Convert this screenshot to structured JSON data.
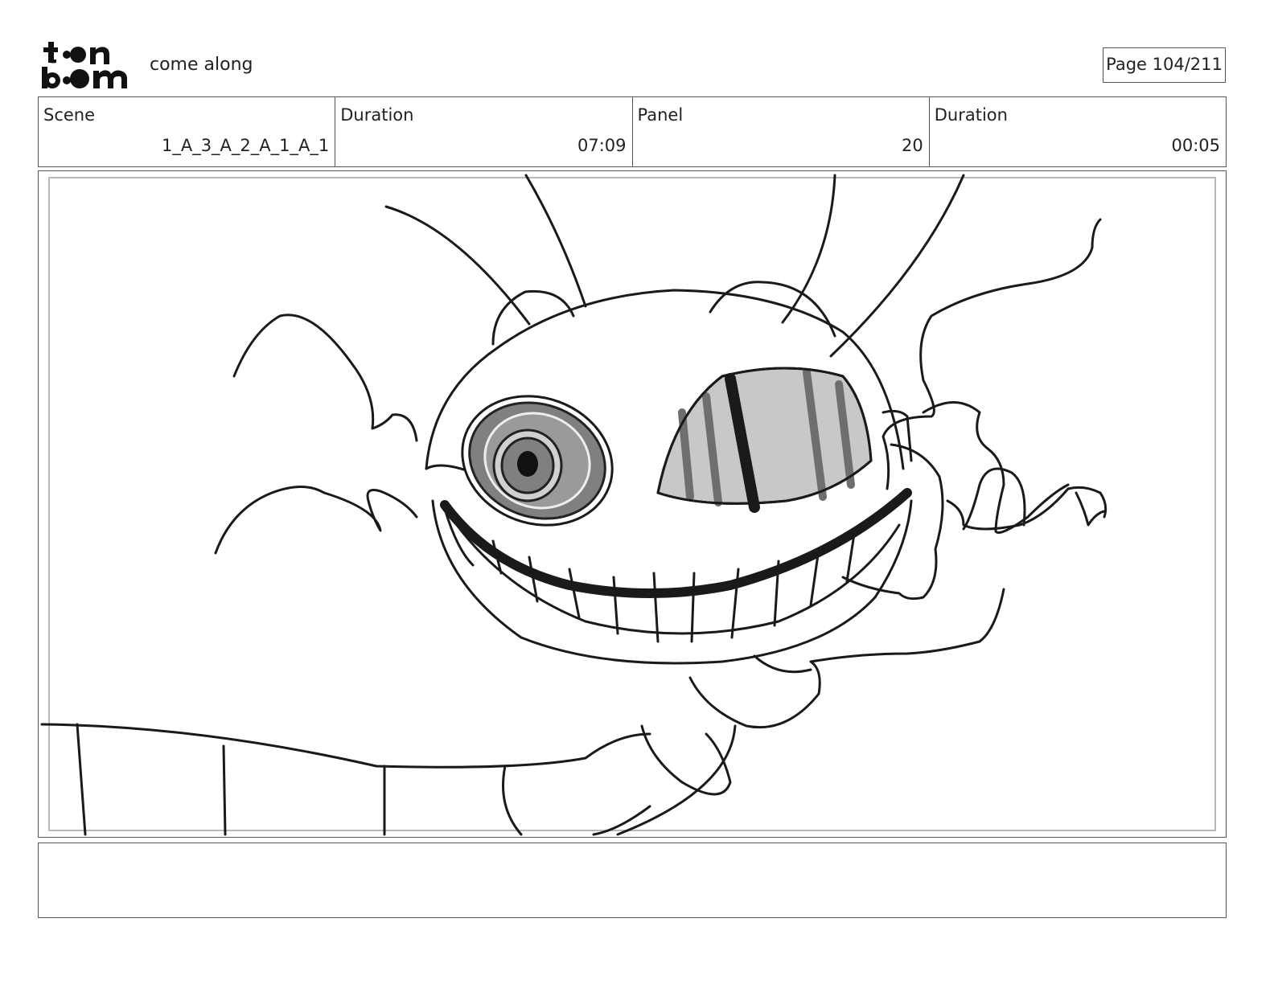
{
  "header": {
    "logo_name": "toon-boom-logo",
    "project_title": "come along",
    "page_label": "Page 104/211"
  },
  "info": [
    {
      "label": "Scene",
      "value": "1_A_3_A_2_A_1_A_1"
    },
    {
      "label": "Duration",
      "value": "07:09"
    },
    {
      "label": "Panel",
      "value": "20"
    },
    {
      "label": "Duration",
      "value": "00:05"
    }
  ],
  "panel": {
    "drawing_description_icon": "sketch-drawing"
  },
  "notes": {
    "text": ""
  }
}
